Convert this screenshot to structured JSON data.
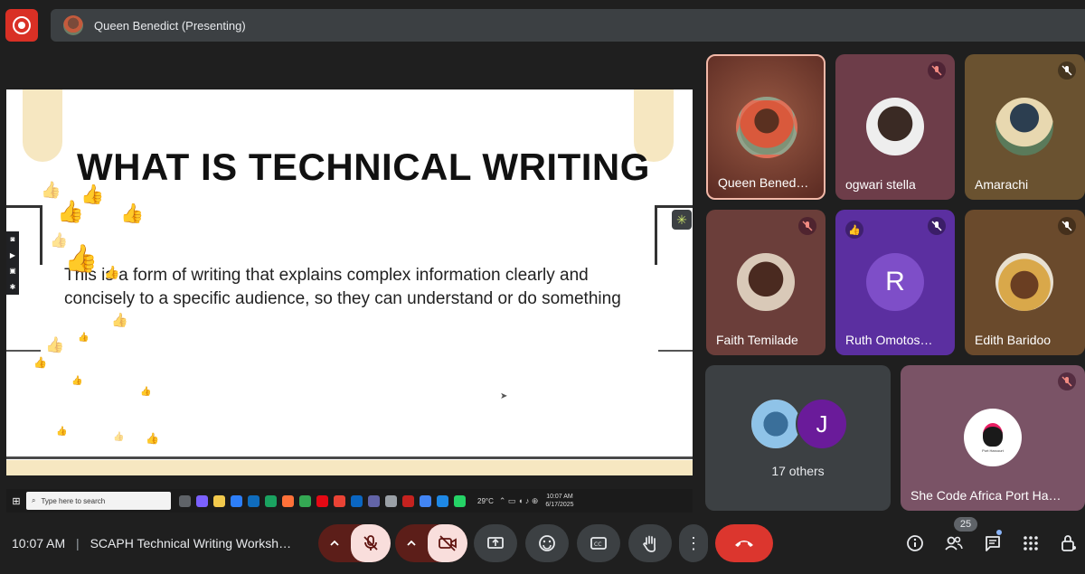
{
  "top_bar": {
    "presenter_label": "Queen Benedict (Presenting)"
  },
  "slide": {
    "title": "WHAT IS TECHNICAL WRITING",
    "body": "This is a form of writing that explains complex information clearly and concisely to a specific audience, so they can understand or do something"
  },
  "taskbar": {
    "search_placeholder": "Type here to search",
    "weather": "29°C",
    "time": "10:07 AM",
    "date": "6/17/2025"
  },
  "participants": [
    {
      "name": "Queen Bened…",
      "muted": false,
      "speaking": true
    },
    {
      "name": "ogwari stella",
      "muted": true
    },
    {
      "name": "Amarachi",
      "muted": true
    },
    {
      "name": "Faith Temilade",
      "muted": true
    },
    {
      "name": "Ruth Omotos…",
      "muted": true,
      "initial": "R",
      "reaction": "👍"
    },
    {
      "name": "Edith Baridoo",
      "muted": true
    }
  ],
  "others": {
    "label": "17 others",
    "initial": "J"
  },
  "featured_tile": {
    "name": "She Code Africa Port Ha…",
    "logo_text": "Port Harcourt"
  },
  "controls": {
    "time": "10:07 AM",
    "separator": "|",
    "meeting_title": "SCAPH Technical Writing Worksh…",
    "people_count": "25"
  },
  "colors": {
    "end_call": "#dc362e",
    "record": "#d93025",
    "muted_control_bg": "#f9dedc"
  }
}
